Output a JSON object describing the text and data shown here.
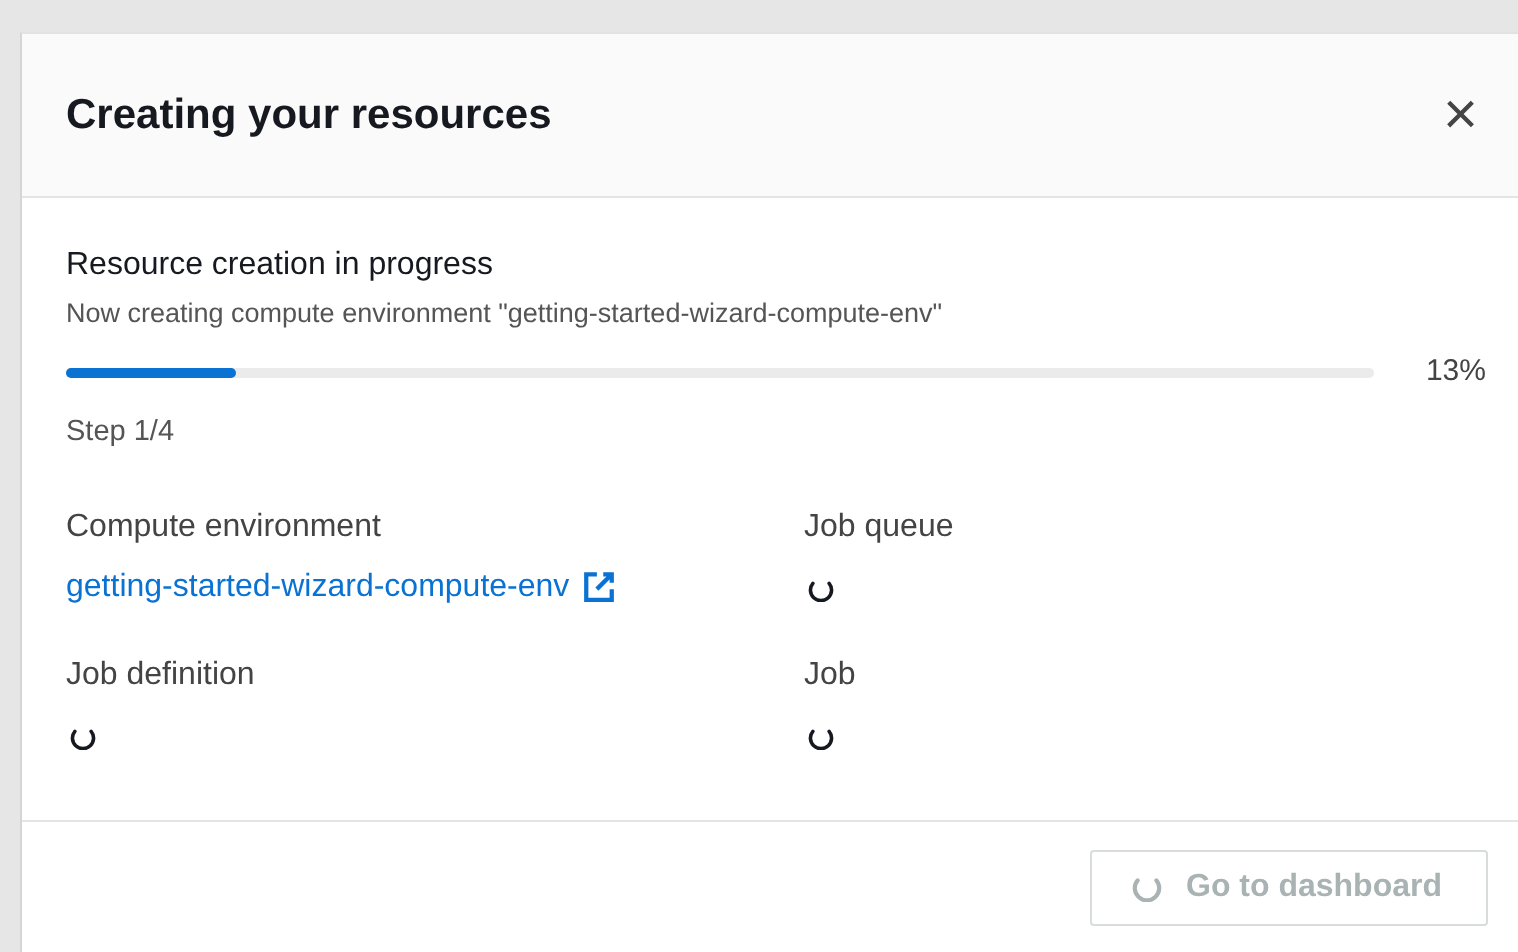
{
  "modal": {
    "title": "Creating your resources",
    "close": "×"
  },
  "progress": {
    "label": "Resource creation in progress",
    "description": "Now creating compute environment \"getting-started-wizard-compute-env\"",
    "level": 0.13,
    "reading": "13%",
    "step": "Step 1/4"
  },
  "resources": [
    {
      "label": "Compute environment",
      "kind": "link",
      "value": "getting-started-wizard-compute-env"
    },
    {
      "label": "Job queue",
      "kind": "loading"
    },
    {
      "label": "Job definition",
      "kind": "loading"
    },
    {
      "label": "Job",
      "kind": "loading"
    }
  ],
  "footer_button": {
    "label": "Go to dashboard",
    "disabled": true,
    "loading": true
  }
}
